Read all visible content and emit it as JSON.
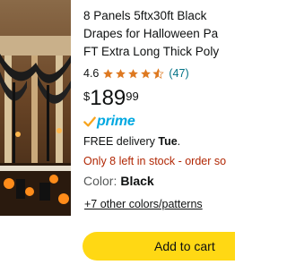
{
  "product": {
    "title_lines": [
      "8 Panels 5ftx30ft Black",
      "Drapes for Halloween Pa",
      "FT Extra Long Thick Poly"
    ],
    "rating_value": "4.6",
    "rating_stars": 4.5,
    "rating_count": "(47)",
    "price": {
      "symbol": "$",
      "whole": "189",
      "fraction": "99"
    },
    "prime_label": "prime",
    "delivery_prefix": "FREE delivery ",
    "delivery_day": "Tue",
    "delivery_suffix": ".",
    "stock_text": "Only 8 left in stock - order so",
    "color_label": "Color:",
    "color_value": "Black",
    "other_colors_link": "+7 other colors/patterns",
    "add_to_cart_label": "Add to cart"
  },
  "colors": {
    "star": "#de7921",
    "link": "#007185",
    "prime": "#00a8e1",
    "stock": "#b12704",
    "cart_button": "#ffd814"
  }
}
